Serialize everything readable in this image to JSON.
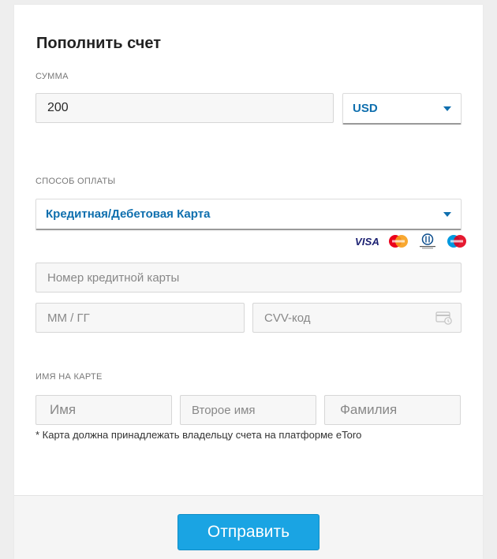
{
  "form": {
    "title": "Пополнить счет",
    "amount": {
      "label": "СУММА",
      "value": "200",
      "currency": "USD"
    },
    "payment_method": {
      "label": "СПОСОБ ОПЛАТЫ",
      "selected": "Кредитная/Дебетовая Карта",
      "card_brands": [
        "visa-logo",
        "mastercard-logo",
        "diners-club-logo",
        "maestro-logo"
      ],
      "visa_text": "VISA"
    },
    "card": {
      "number_placeholder": "Номер кредитной карты",
      "expiry_placeholder": "ММ / ГГ",
      "cvv_placeholder": "CVV-код"
    },
    "name": {
      "label": "ИМЯ НА КАРТЕ",
      "first_placeholder": "Имя",
      "middle_placeholder": "Второе имя",
      "last_placeholder": "Фамилия"
    },
    "note": "* Карта должна принадлежать владельцу счета на платформе eToro",
    "submit_label": "Отправить"
  },
  "colors": {
    "accent": "#0f6fae",
    "button": "#1aa4e3",
    "page_bg": "#eeeeee",
    "panel_bg": "#ffffff"
  }
}
